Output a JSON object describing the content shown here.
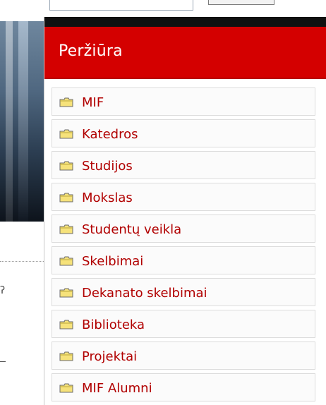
{
  "panel": {
    "title": "Peržiūra",
    "accent_color": "#d40000",
    "link_color": "#b10000",
    "items": [
      {
        "label": "MIF",
        "icon": "folder-icon"
      },
      {
        "label": "Katedros",
        "icon": "folder-icon"
      },
      {
        "label": "Studijos",
        "icon": "folder-icon"
      },
      {
        "label": "Mokslas",
        "icon": "folder-icon"
      },
      {
        "label": "Studentų veikla",
        "icon": "folder-icon"
      },
      {
        "label": "Skelbimai",
        "icon": "folder-icon"
      },
      {
        "label": "Dekanato skelbimai",
        "icon": "folder-icon"
      },
      {
        "label": "Biblioteka",
        "icon": "folder-icon"
      },
      {
        "label": "Projektai",
        "icon": "folder-icon"
      },
      {
        "label": "MIF Alumni",
        "icon": "folder-icon"
      }
    ]
  }
}
